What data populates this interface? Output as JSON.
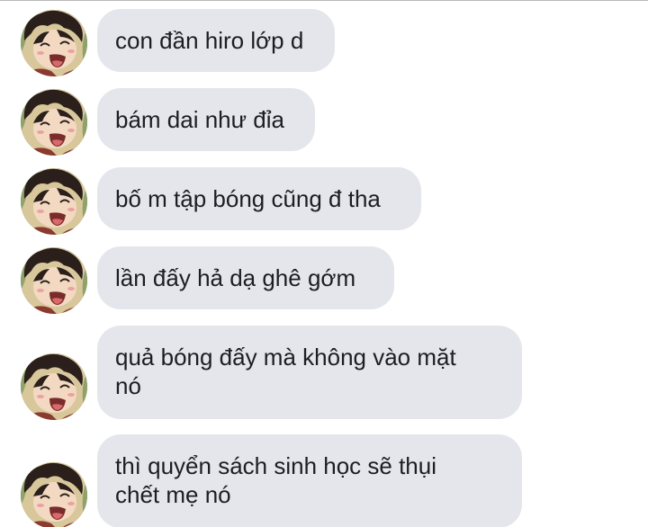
{
  "conversation": {
    "messages": [
      {
        "text": "con đần hiro lớp d"
      },
      {
        "text": "bám dai như đỉa"
      },
      {
        "text": "bố m tập bóng cũng đ tha"
      },
      {
        "text": "lần đấy hả dạ ghê gớm"
      },
      {
        "text": "quả bóng đấy mà không vào mặt\nnó"
      },
      {
        "text": "thì quyển sách sinh học sẽ thụi\nchết mẹ nó"
      }
    ],
    "avatar_icon": "anime-boy-laughing-avatar",
    "colors": {
      "bubble_bg": "#e4e6eb",
      "text": "#1c1e21",
      "background": "#ffffff"
    }
  }
}
